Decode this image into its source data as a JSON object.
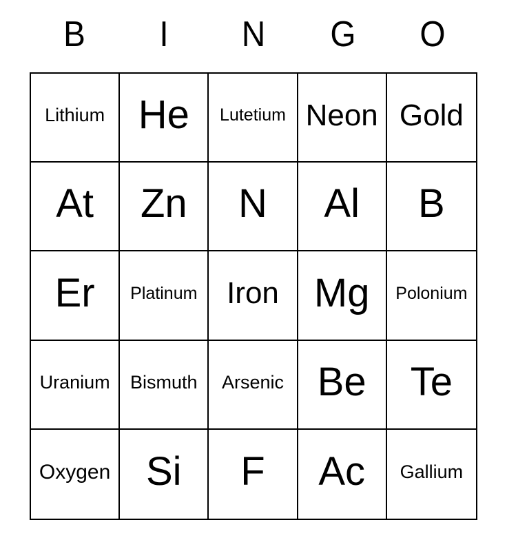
{
  "card": {
    "headers": [
      "B",
      "I",
      "N",
      "G",
      "O"
    ],
    "rows": [
      [
        "Lithium",
        "He",
        "Lutetium",
        "Neon",
        "Gold"
      ],
      [
        "At",
        "Zn",
        "N",
        "Al",
        "B"
      ],
      [
        "Er",
        "Platinum",
        "Iron",
        "Mg",
        "Polonium"
      ],
      [
        "Uranium",
        "Bismuth",
        "Arsenic",
        "Be",
        "Te"
      ],
      [
        "Oxygen",
        "Si",
        "F",
        "Ac",
        "Gallium"
      ]
    ],
    "colors": {
      "ink": "#000000",
      "paper": "#ffffff",
      "grid_line": "#000000"
    }
  }
}
